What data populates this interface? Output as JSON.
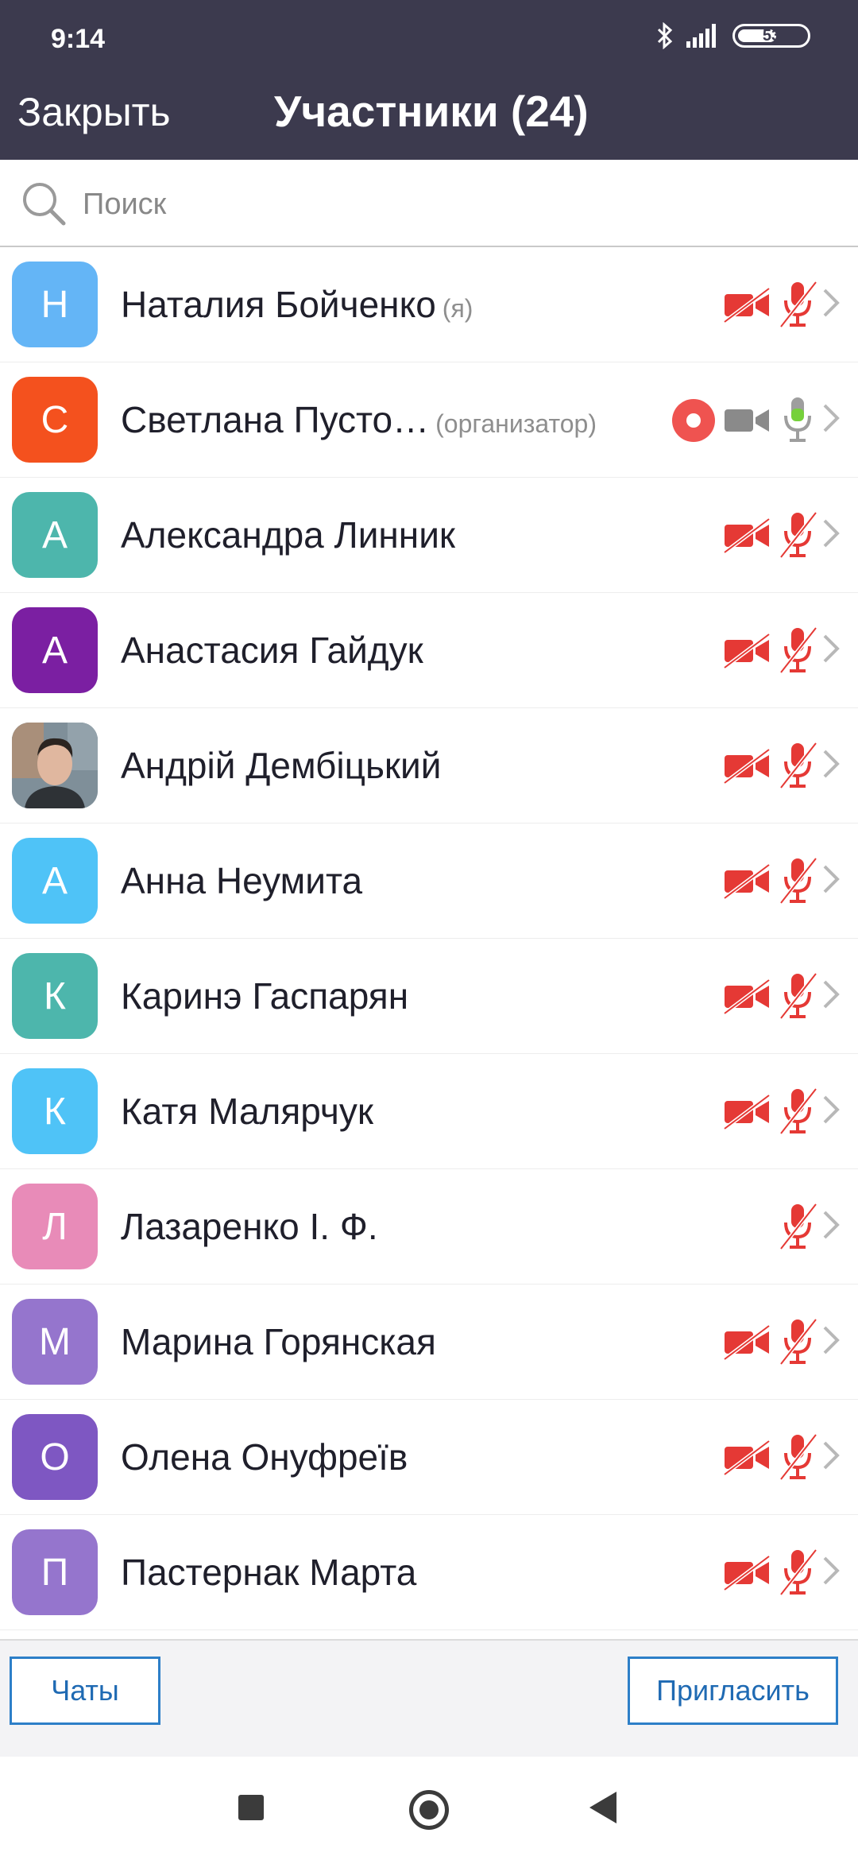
{
  "status": {
    "time": "9:14",
    "battery": "53"
  },
  "header": {
    "close_label": "Закрыть",
    "title": "Участники (24)"
  },
  "search": {
    "placeholder": "Поиск"
  },
  "participants": [
    {
      "initial": "Н",
      "name": "Наталия Бойченко",
      "tag": "(я)",
      "color": "#64b5f6",
      "icons": "off-both"
    },
    {
      "initial": "С",
      "name": "Светлана Пусто…",
      "tag": "(организатор)",
      "color": "#f4511e",
      "icons": "host"
    },
    {
      "initial": "А",
      "name": "Александра Линник",
      "tag": "",
      "color": "#4db6ac",
      "icons": "off-both"
    },
    {
      "initial": "А",
      "name": "Анастасия Гайдук",
      "tag": "",
      "color": "#7b1fa2",
      "icons": "off-both"
    },
    {
      "initial": "",
      "name": "Андрій Дембіцький",
      "tag": "",
      "color": "#6d7c86",
      "icons": "off-both",
      "photo": true
    },
    {
      "initial": "А",
      "name": "Анна Неумита",
      "tag": "",
      "color": "#4fc3f7",
      "icons": "off-both"
    },
    {
      "initial": "К",
      "name": "Каринэ Гаспарян",
      "tag": "",
      "color": "#4db6ac",
      "icons": "off-both"
    },
    {
      "initial": "К",
      "name": "Катя Малярчук",
      "tag": "",
      "color": "#4fc3f7",
      "icons": "off-both"
    },
    {
      "initial": "Л",
      "name": "Лазаренко І. Ф.",
      "tag": "",
      "color": "#e88bb8",
      "icons": "mic-only"
    },
    {
      "initial": "М",
      "name": "Марина Горянская",
      "tag": "",
      "color": "#9575cd",
      "icons": "off-both"
    },
    {
      "initial": "О",
      "name": "Олена Онуфреїв",
      "tag": "",
      "color": "#7e57c2",
      "icons": "off-both"
    },
    {
      "initial": "П",
      "name": "Пастернак Марта",
      "tag": "",
      "color": "#9575cd",
      "icons": "off-both"
    }
  ],
  "footer": {
    "chats_label": "Чаты",
    "invite_label": "Пригласить"
  },
  "colors": {
    "header_bg": "#3c3a4e",
    "muted_red": "#e53935",
    "mic_on_green": "#76d13b",
    "button_blue": "#1f6ab3"
  },
  "icons": {
    "video_off": "video-off-icon",
    "mic_off": "mic-off-icon",
    "mic_on": "mic-on-icon",
    "video": "video-icon",
    "recording": "recording-icon",
    "chevron": "chevron-right-icon"
  }
}
